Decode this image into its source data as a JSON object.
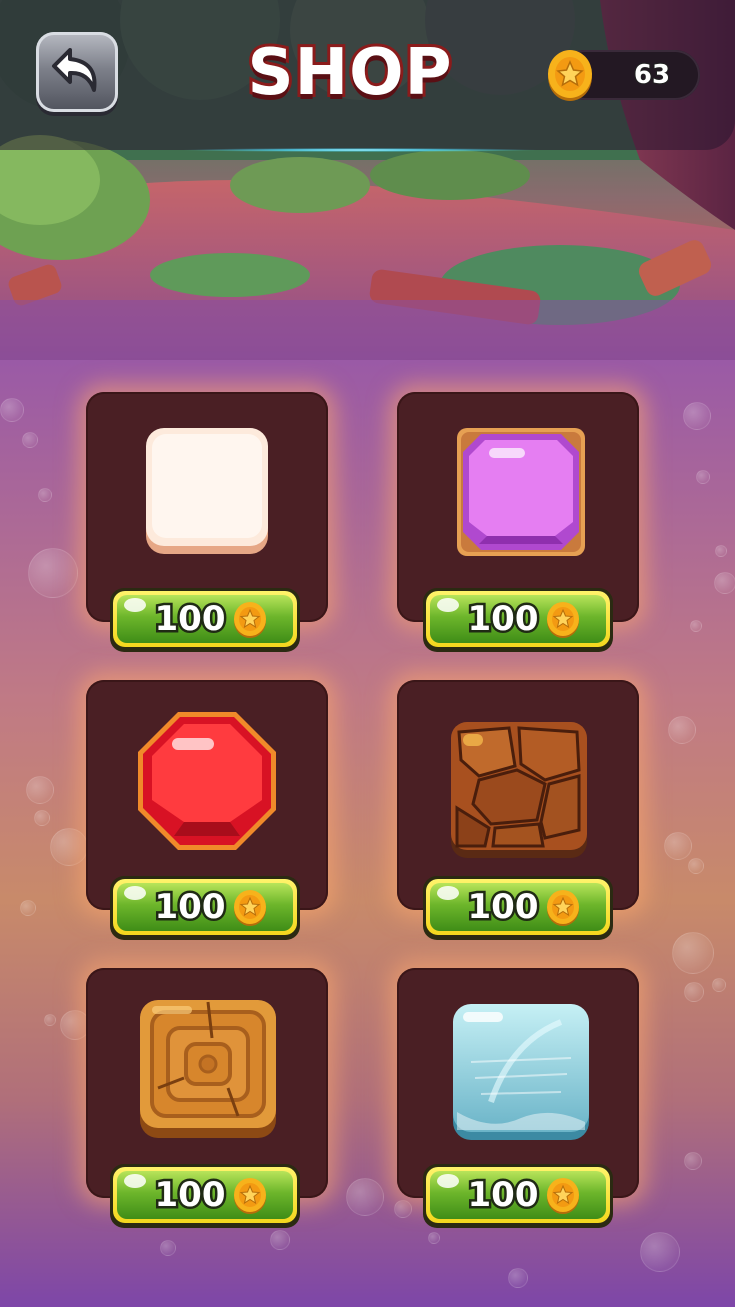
{
  "header": {
    "title": "SHOP",
    "coins": "63"
  },
  "colors": {
    "coin": "#f7b21b",
    "button_green": "#6db62b",
    "button_rim": "#f4d71d",
    "card": "#4a1f24"
  },
  "shop": {
    "items": [
      {
        "name": "plain-tile",
        "price": "100",
        "icon": "cream-square-icon"
      },
      {
        "name": "purple-gem",
        "price": "100",
        "icon": "purple-gem-icon"
      },
      {
        "name": "red-gem",
        "price": "100",
        "icon": "red-octagon-gem-icon"
      },
      {
        "name": "stone-block",
        "price": "100",
        "icon": "brown-stone-block-icon"
      },
      {
        "name": "wood-block",
        "price": "100",
        "icon": "wood-block-icon"
      },
      {
        "name": "ice-block",
        "price": "100",
        "icon": "ice-block-icon"
      }
    ]
  }
}
